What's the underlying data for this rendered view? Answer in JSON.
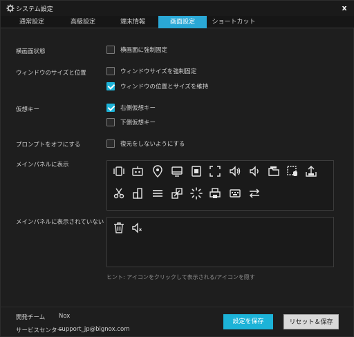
{
  "window": {
    "title": "システム設定",
    "close_glyph": "x"
  },
  "tabs": [
    {
      "label": "通常設定",
      "active": false
    },
    {
      "label": "高級設定",
      "active": false
    },
    {
      "label": "端末情報",
      "active": false
    },
    {
      "label": "画面設定",
      "active": true
    },
    {
      "label": "ショートカット",
      "active": false
    }
  ],
  "settings": {
    "landscape": {
      "label": "横画面状態",
      "options": [
        {
          "label": "横画面に強制固定",
          "checked": false
        }
      ]
    },
    "window": {
      "label": "ウィンドウのサイズと位置",
      "options": [
        {
          "label": "ウィンドウサイズを強制固定",
          "checked": false
        },
        {
          "label": "ウィンドウの位置とサイズを維持",
          "checked": true
        }
      ]
    },
    "virtual_keys": {
      "label": "仮想キー",
      "options": [
        {
          "label": "右側仮想キー",
          "checked": true
        },
        {
          "label": "下側仮想キー",
          "checked": false
        }
      ]
    },
    "prompt": {
      "label": "プロンプトをオフにする",
      "options": [
        {
          "label": "復元をしないようにする",
          "checked": false
        }
      ]
    },
    "main_panel_shown": {
      "label": "メインパネルに表示",
      "icons": [
        "shake-icon",
        "robot-icon",
        "location-icon",
        "screen-icon",
        "record-icon",
        "fullscreen-icon",
        "volume-up-icon",
        "volume-down-icon",
        "folder-icon",
        "macro-icon",
        "upload-apk-icon",
        "scissors-icon",
        "multi-window-icon",
        "menu-icon",
        "screenshot-icon",
        "loading-icon",
        "printer-icon",
        "keyboard-icon",
        "sync-icon"
      ]
    },
    "main_panel_hidden": {
      "label": "メインパネルに表示されていない",
      "icons": [
        "trash-icon",
        "mute-icon"
      ]
    },
    "hint": "ヒント: アイコンをクリックして表示される/アイコンを隠す"
  },
  "footer": {
    "dev_team_label": "開発チーム",
    "dev_team_value": "Nox",
    "service_label": "サービスセンター",
    "service_value": "support_jp@bignox.com",
    "save_label": "設定を保存",
    "reset_label": "リセット＆保存"
  },
  "colors": {
    "accent": "#1cb3d8",
    "tab_active": "#2aa8d6",
    "background": "#1e1e1e"
  }
}
